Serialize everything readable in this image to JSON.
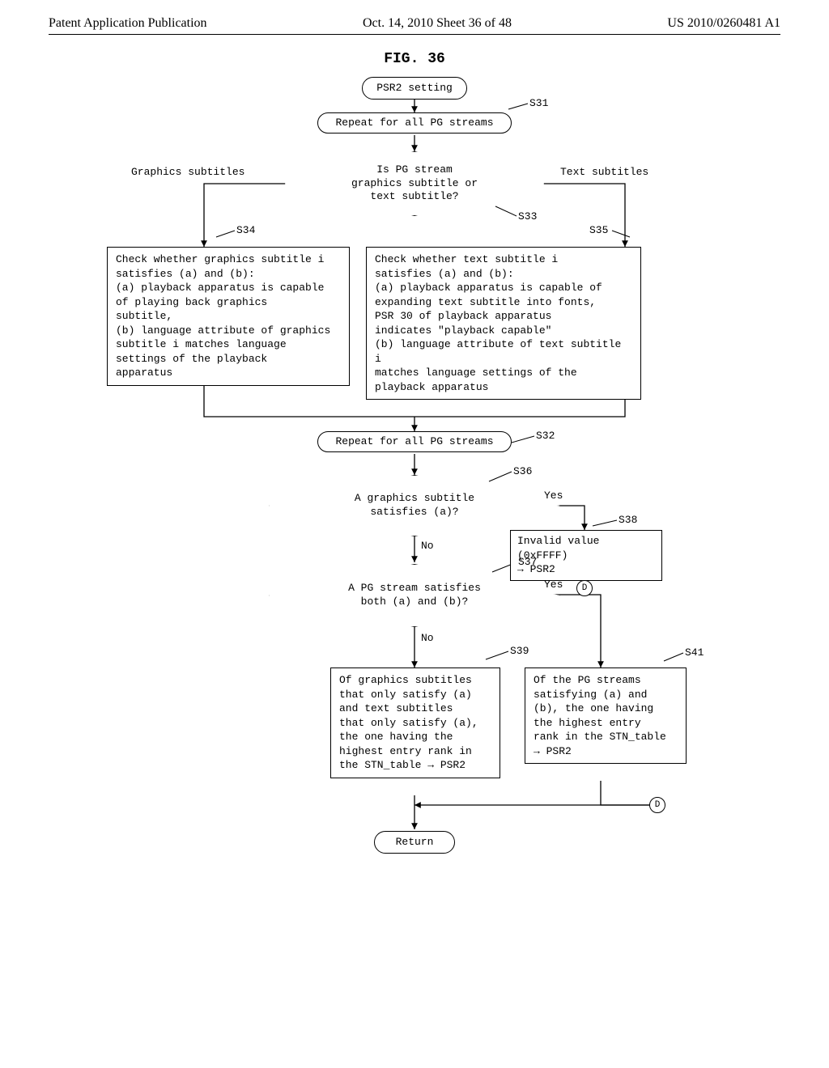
{
  "header": {
    "left": "Patent Application Publication",
    "center": "Oct. 14, 2010  Sheet 36 of 48",
    "right": "US 2010/0260481 A1"
  },
  "figure_title": "FIG. 36",
  "nodes": {
    "start": "PSR2 setting",
    "loop_top": "Repeat for all PG streams",
    "d1": "Is PG stream\ngraphics subtitle or\ntext subtitle?",
    "d1_left": "Graphics subtitles",
    "d1_right": "Text subtitles",
    "s34": "Check whether graphics subtitle i\nsatisfies (a) and (b):\n(a) playback apparatus is capable\n    of playing back graphics\n    subtitle,\n(b) language attribute of graphics\n    subtitle i matches language\n    settings of the playback\n    apparatus",
    "s35": "Check whether text subtitle i\nsatisfies (a) and (b):\n(a) playback apparatus is capable of\n    expanding text subtitle into fonts,\n    PSR 30 of playback apparatus\n    indicates \"playback capable\"\n(b) language attribute of text subtitle i\n    matches language settings of the\n    playback apparatus",
    "loop_bottom": "Repeat for all PG streams",
    "d2": "A graphics subtitle\nsatisfies (a)?",
    "d2_yes": "Yes",
    "d2_no": "No",
    "s38": "Invalid value (0xFFFF)\n   →  PSR2",
    "d3": "A PG stream satisfies\nboth (a) and (b)?",
    "d3_yes": "Yes",
    "d3_no": "No",
    "s39": "Of graphics subtitles\nthat only satisfy (a)\nand text subtitles\nthat only satisfy (a),\nthe one having the\nhighest entry rank in\nthe STN_table →  PSR2",
    "s41": "Of the PG streams\nsatisfying (a) and\n(b), the one having\nthe highest entry\nrank in the STN_table\n→  PSR2",
    "return": "Return",
    "connector": "D"
  },
  "steps": {
    "s31": "S31",
    "s32": "S32",
    "s33": "S33",
    "s34": "S34",
    "s35": "S35",
    "s36": "S36",
    "s37": "S37",
    "s38": "S38",
    "s39": "S39",
    "s41": "S41"
  },
  "chart_data": {
    "type": "flowchart",
    "title": "FIG. 36 — PSR2 setting",
    "nodes": [
      {
        "id": "start",
        "type": "terminator",
        "label": "PSR2 setting"
      },
      {
        "id": "loop_top",
        "type": "loop_start",
        "step": "S31",
        "label": "Repeat for all PG streams"
      },
      {
        "id": "d1",
        "type": "decision",
        "step": "S33",
        "label": "Is PG stream graphics subtitle or text subtitle?"
      },
      {
        "id": "s34",
        "type": "process",
        "step": "S34",
        "label": "Check whether graphics subtitle i satisfies (a) and (b): (a) playback apparatus is capable of playing back graphics subtitle, (b) language attribute of graphics subtitle i matches language settings of the playback apparatus"
      },
      {
        "id": "s35",
        "type": "process",
        "step": "S35",
        "label": "Check whether text subtitle i satisfies (a) and (b): (a) playback apparatus is capable of expanding text subtitle into fonts, PSR 30 of playback apparatus indicates \"playback capable\" (b) language attribute of text subtitle i matches language settings of the playback apparatus"
      },
      {
        "id": "loop_bottom",
        "type": "loop_end",
        "step": "S32",
        "label": "Repeat for all PG streams"
      },
      {
        "id": "d2",
        "type": "decision",
        "step": "S36",
        "label": "A graphics subtitle satisfies (a)?"
      },
      {
        "id": "s38",
        "type": "process",
        "step": "S38",
        "label": "Invalid value (0xFFFF) → PSR2"
      },
      {
        "id": "D1",
        "type": "connector",
        "label": "D"
      },
      {
        "id": "d3",
        "type": "decision",
        "step": "S37",
        "label": "A PG stream satisfies both (a) and (b)?"
      },
      {
        "id": "s39",
        "type": "process",
        "step": "S39",
        "label": "Of graphics subtitles that only satisfy (a) and text subtitles that only satisfy (a), the one having the highest entry rank in the STN_table → PSR2"
      },
      {
        "id": "s41",
        "type": "process",
        "step": "S41",
        "label": "Of the PG streams satisfying (a) and (b), the one having the highest entry rank in the STN_table → PSR2"
      },
      {
        "id": "D2",
        "type": "connector",
        "label": "D"
      },
      {
        "id": "return",
        "type": "terminator",
        "label": "Return"
      }
    ],
    "edges": [
      {
        "from": "start",
        "to": "loop_top"
      },
      {
        "from": "loop_top",
        "to": "d1"
      },
      {
        "from": "d1",
        "to": "s34",
        "label": "Graphics subtitles"
      },
      {
        "from": "d1",
        "to": "s35",
        "label": "Text subtitles"
      },
      {
        "from": "s34",
        "to": "loop_bottom"
      },
      {
        "from": "s35",
        "to": "loop_bottom"
      },
      {
        "from": "loop_bottom",
        "to": "d2"
      },
      {
        "from": "d2",
        "to": "s38",
        "label": "Yes"
      },
      {
        "from": "s38",
        "to": "D1"
      },
      {
        "from": "d2",
        "to": "d3",
        "label": "No"
      },
      {
        "from": "d3",
        "to": "s41",
        "label": "Yes"
      },
      {
        "from": "d3",
        "to": "s39",
        "label": "No"
      },
      {
        "from": "s39",
        "to": "return"
      },
      {
        "from": "s41",
        "to": "D2"
      },
      {
        "from": "D2",
        "to": "return"
      },
      {
        "from": "D1",
        "to": "return"
      }
    ]
  }
}
